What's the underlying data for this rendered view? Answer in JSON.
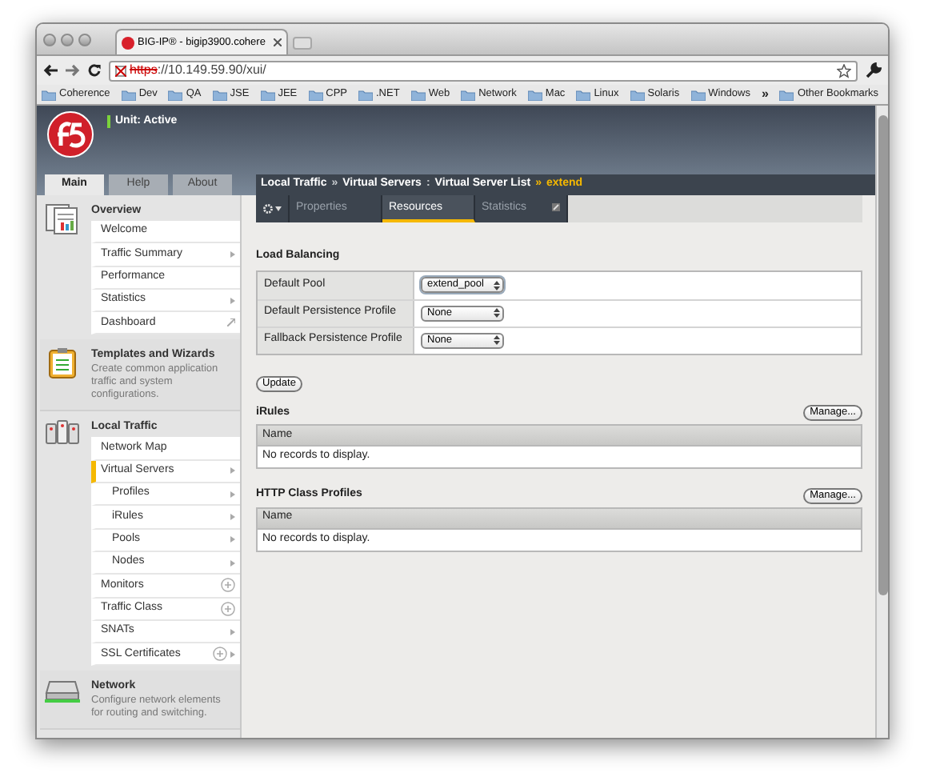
{
  "browser": {
    "tab_title": "BIG-IP® - bigip3900.cohere",
    "url_scheme": "https",
    "url_rest": "://10.149.59.90/xui/",
    "bookmarks": [
      "Coherence",
      "Dev",
      "QA",
      "JSE",
      "JEE",
      "CPP",
      ".NET",
      "Web",
      "Network",
      "Mac",
      "Linux",
      "Solaris",
      "Windows"
    ],
    "bookmarks_overflow": "»",
    "other_bookmarks": "Other Bookmarks"
  },
  "header": {
    "unit_status": "Unit: Active"
  },
  "nav_tabs": [
    {
      "label": "Main",
      "selected": true
    },
    {
      "label": "Help",
      "selected": false
    },
    {
      "label": "About",
      "selected": false
    }
  ],
  "sidebar": [
    {
      "kind": "overview",
      "title": "Overview",
      "items": [
        {
          "label": "Welcome",
          "kind": "plain",
          "selected": false
        },
        {
          "label": "Traffic Summary",
          "kind": "arrow",
          "selected": false
        },
        {
          "label": "Performance",
          "kind": "plain",
          "selected": false
        },
        {
          "label": "Statistics",
          "kind": "arrow",
          "selected": false
        },
        {
          "label": "Dashboard",
          "kind": "popout",
          "selected": false
        }
      ]
    },
    {
      "kind": "templates",
      "title": "Templates and Wizards",
      "description": "Create common application traffic and system configurations."
    },
    {
      "kind": "local_traffic",
      "title": "Local Traffic",
      "items": [
        {
          "label": "Network Map",
          "kind": "plain",
          "selected": false
        },
        {
          "label": "Virtual Servers",
          "kind": "arrow",
          "selected": true,
          "children": [
            {
              "label": "Profiles",
              "kind": "arrow",
              "selected": false
            },
            {
              "label": "iRules",
              "kind": "arrow",
              "selected": false
            },
            {
              "label": "Pools",
              "kind": "arrow",
              "selected": false
            },
            {
              "label": "Nodes",
              "kind": "arrow",
              "selected": false
            }
          ]
        },
        {
          "label": "Monitors",
          "kind": "plus",
          "selected": false
        },
        {
          "label": "Traffic Class",
          "kind": "plus",
          "selected": false
        },
        {
          "label": "SNATs",
          "kind": "arrow",
          "selected": false
        },
        {
          "label": "SSL Certificates",
          "kind": "plus_arrow",
          "selected": false
        }
      ]
    },
    {
      "kind": "network",
      "title": "Network",
      "description": "Configure network elements for routing and switching."
    }
  ],
  "breadcrumb": {
    "parts": [
      "Local Traffic",
      "Virtual Servers",
      "Virtual Server List",
      "extend"
    ],
    "separators": [
      "»",
      ":",
      "»"
    ]
  },
  "tabs": [
    {
      "label": "Properties",
      "selected": false
    },
    {
      "label": "Resources",
      "selected": true
    },
    {
      "label": "Statistics",
      "selected": false
    }
  ],
  "load_balancing": {
    "title": "Load Balancing",
    "rows": [
      {
        "label": "Default Pool",
        "value": "extend_pool"
      },
      {
        "label": "Default Persistence Profile",
        "value": "None"
      },
      {
        "label": "Fallback Persistence Profile",
        "value": "None"
      }
    ],
    "update_button": "Update"
  },
  "record_sections": [
    {
      "title": "iRules",
      "manage_button": "Manage...",
      "column": "Name",
      "empty_text": "No records to display."
    },
    {
      "title": "HTTP Class Profiles",
      "manage_button": "Manage...",
      "column": "Name",
      "empty_text": "No records to display."
    }
  ]
}
